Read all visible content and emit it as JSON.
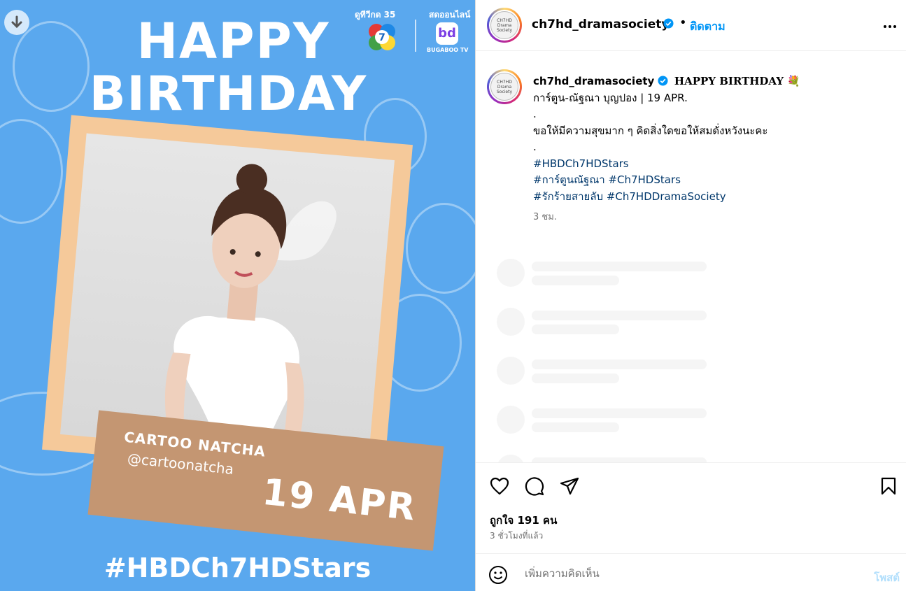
{
  "image": {
    "headline_line1": "HAPPY",
    "headline_line2": "BIRTHDAY",
    "channel_label": "ดูทีวีกด 35",
    "stream_label": "สดออนไลน์",
    "stream_brand": "BUGABOO TV",
    "stream_logo": "bd",
    "name": "CARTOO NATCHA",
    "handle": "@cartoonatcha",
    "date": "19 APR",
    "hashtag": "#HBDCh7HDStars",
    "bg_color": "#5aa8ee",
    "frame_color": "#f5c99a",
    "plate_color": "#c49672"
  },
  "header": {
    "username": "ch7hd_dramasociety",
    "separator": "•",
    "follow_label": "ติดตาม",
    "more_icon": "more-horizontal-icon",
    "avatar_text": "CH7HD Drama Society"
  },
  "caption": {
    "username": "ch7hd_dramasociety",
    "title": "HAPPY BIRTHDAY 💐",
    "line1": "การ์ตูน-ณัฐณา บุญปอง | 19 APR.",
    "dot1": ".",
    "line2": "ขอให้มีความสุขมาก ๆ คิดสิ่งใดขอให้สมดั่งหวังนะคะ",
    "dot2": ".",
    "tag1": "#HBDCh7HDStars",
    "tag2": "#การ์ตูนณัฐณา",
    "tag3": "#Ch7HDStars",
    "tag4": "#รักร้ายสายลับ",
    "tag5": "#Ch7HDDramaSociety",
    "time": "3 ชม."
  },
  "actions": {
    "likes": "ถูกใจ 191 คน",
    "ago": "3 ชั่วโมงที่แล้ว"
  },
  "comment": {
    "placeholder": "เพิ่มความคิดเห็น",
    "post_label": "โพสต์"
  },
  "colors": {
    "link_blue": "#0095f6",
    "hashtag": "#00376b",
    "muted": "#737373"
  }
}
